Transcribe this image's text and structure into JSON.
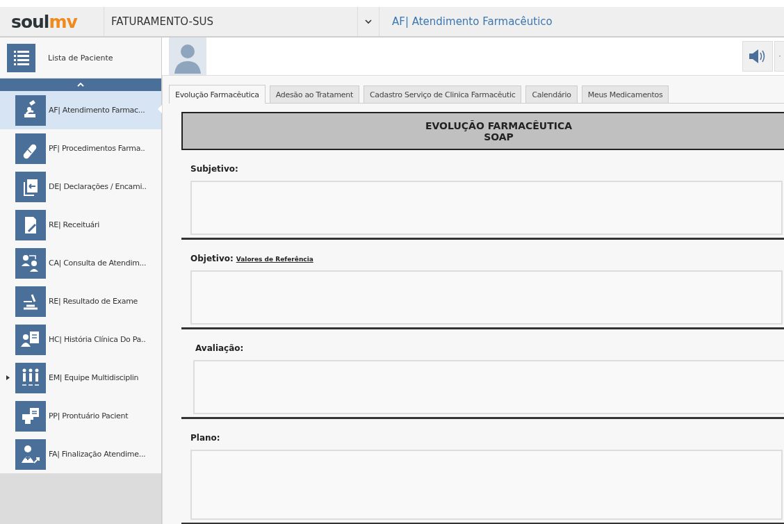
{
  "header": {
    "logo": "soulmv",
    "context": "FATURAMENTO-SUS",
    "module": "AF| Atendimento Farmacêutico"
  },
  "patient_bar": {
    "list_label": "Lista de Paciente"
  },
  "sidebar": {
    "items": [
      {
        "label": "AF| Atendimento Farmac...",
        "selected": true
      },
      {
        "label": "PF| Procedimentos Farma..",
        "selected": false
      },
      {
        "label": "DE| Declarações / Encami..",
        "selected": false
      },
      {
        "label": "RE| Receituári",
        "selected": false
      },
      {
        "label": "CA| Consulta de Atendim...",
        "selected": false
      },
      {
        "label": "RE| Resultado de Exame",
        "selected": false
      },
      {
        "label": "HC| História Clínica Do Pa..",
        "selected": false
      },
      {
        "label": "EM| Equipe Multidisciplin",
        "selected": false,
        "pointer": true
      },
      {
        "label": "PP| Prontuário Pacient",
        "selected": false
      },
      {
        "label": "FA| Finalização Atendime...",
        "selected": false
      }
    ]
  },
  "tabs": [
    {
      "label": "Evolução Farmacêutica",
      "selected": true
    },
    {
      "label": "Adesão ao Tratament",
      "selected": false
    },
    {
      "label": "Cadastro Serviço de Clinica Farmacêutic",
      "selected": false
    },
    {
      "label": "Calendário",
      "selected": false
    },
    {
      "label": "Meus Medicamentos",
      "selected": false
    }
  ],
  "form": {
    "title": "EVOLUÇÃO FARMACÊUTICA",
    "subtitle": "SOAP",
    "sections": [
      {
        "label": "Subjetivo:"
      },
      {
        "label": "Objetivo:",
        "link": "Valores de Referência"
      },
      {
        "label": "Avaliação:"
      },
      {
        "label": "Plano:"
      }
    ]
  }
}
